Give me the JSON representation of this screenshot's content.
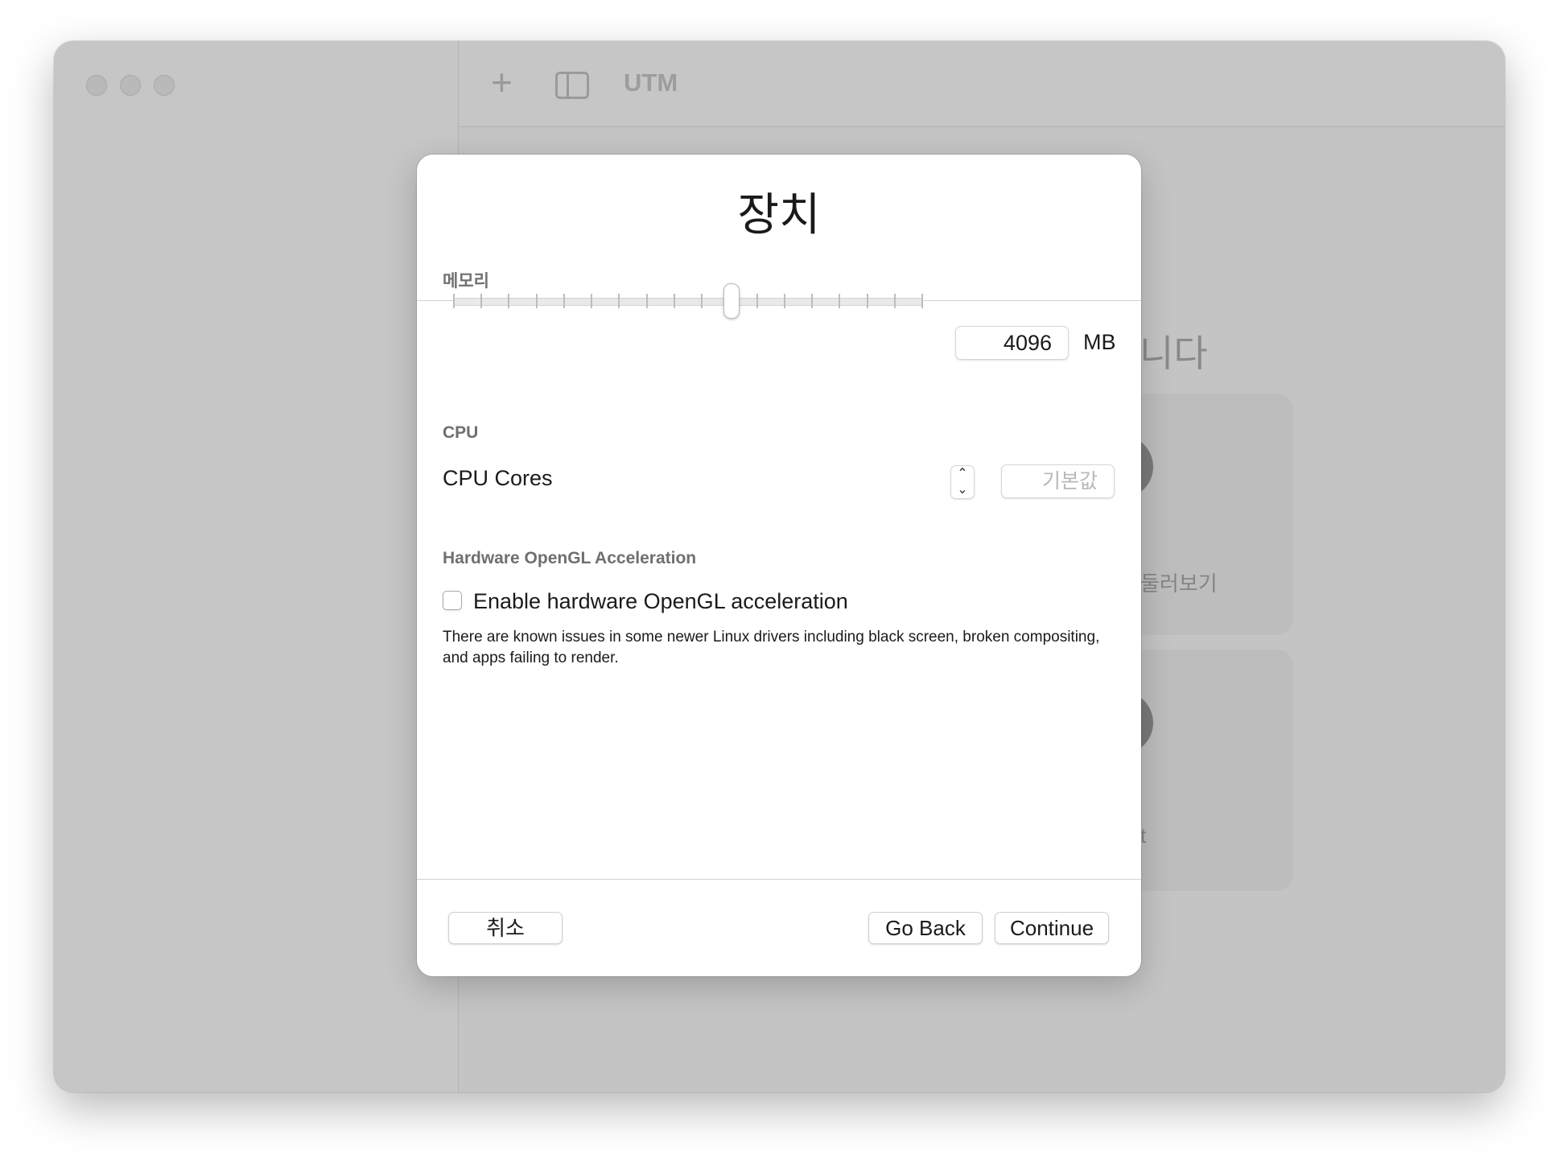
{
  "window": {
    "app_title": "UTM",
    "background_heading": "니다",
    "background_cards": [
      {
        "label": "둘러보기"
      },
      {
        "label": "t"
      }
    ]
  },
  "dialog": {
    "title": "장치",
    "memory": {
      "section_label": "메모리",
      "value": "4096",
      "unit": "MB",
      "slider_position_fraction": 0.59,
      "tick_count": 18
    },
    "cpu": {
      "section_label": "CPU",
      "cores_label": "CPU Cores",
      "cores_placeholder": "기본값",
      "stepper_up_icon": "chevron-up-icon",
      "stepper_down_icon": "chevron-down-icon"
    },
    "opengl": {
      "section_label": "Hardware OpenGL Acceleration",
      "checkbox_label": "Enable hardware OpenGL acceleration",
      "checked": false,
      "note": "There are known issues in some newer Linux drivers including black screen, broken compositing, and apps failing to render."
    },
    "buttons": {
      "cancel": "취소",
      "go_back": "Go Back",
      "continue": "Continue"
    }
  }
}
